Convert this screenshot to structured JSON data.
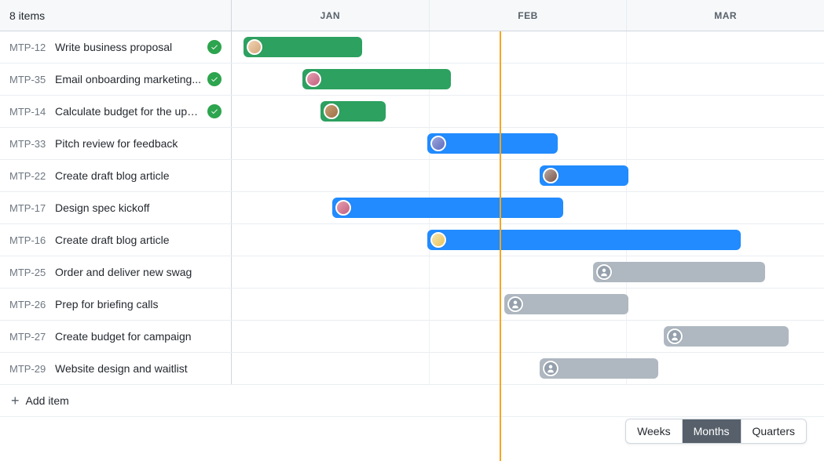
{
  "header": {
    "count_label": "8 items",
    "months": [
      "JAN",
      "FEB",
      "MAR"
    ]
  },
  "timeline": {
    "today_position_pct": 45.2
  },
  "tasks": [
    {
      "code": "MTP-12",
      "title": "Write business proposal",
      "done": true,
      "color": "green",
      "start_pct": 2,
      "width_pct": 20,
      "avatar": "a1"
    },
    {
      "code": "MTP-35",
      "title": "Email onboarding marketing...",
      "done": true,
      "color": "green",
      "start_pct": 12,
      "width_pct": 25,
      "avatar": "a2"
    },
    {
      "code": "MTP-14",
      "title": "Calculate budget for the upc...",
      "done": true,
      "color": "green",
      "start_pct": 15,
      "width_pct": 11,
      "avatar": "a3"
    },
    {
      "code": "MTP-33",
      "title": "Pitch review for feedback",
      "done": false,
      "color": "blue",
      "start_pct": 33,
      "width_pct": 22,
      "avatar": "a4"
    },
    {
      "code": "MTP-22",
      "title": "Create draft blog article",
      "done": false,
      "color": "blue",
      "start_pct": 52,
      "width_pct": 15,
      "avatar": "a5"
    },
    {
      "code": "MTP-17",
      "title": "Design spec kickoff",
      "done": false,
      "color": "blue",
      "start_pct": 17,
      "width_pct": 39,
      "avatar": "a2"
    },
    {
      "code": "MTP-16",
      "title": "Create draft blog article",
      "done": false,
      "color": "blue",
      "start_pct": 33,
      "width_pct": 53,
      "avatar": "a6"
    },
    {
      "code": "MTP-25",
      "title": "Order and deliver new swag",
      "done": false,
      "color": "grey",
      "start_pct": 61,
      "width_pct": 29,
      "avatar": "generic"
    },
    {
      "code": "MTP-26",
      "title": "Prep for briefing calls",
      "done": false,
      "color": "grey",
      "start_pct": 46,
      "width_pct": 21,
      "avatar": "generic"
    },
    {
      "code": "MTP-27",
      "title": "Create budget for campaign",
      "done": false,
      "color": "grey",
      "start_pct": 73,
      "width_pct": 21,
      "avatar": "generic"
    },
    {
      "code": "MTP-29",
      "title": "Website design and waitlist",
      "done": false,
      "color": "grey",
      "start_pct": 52,
      "width_pct": 20,
      "avatar": "generic"
    }
  ],
  "footer": {
    "add_item_label": "Add item"
  },
  "zoom": {
    "options": [
      "Weeks",
      "Months",
      "Quarters"
    ],
    "active_index": 1
  }
}
